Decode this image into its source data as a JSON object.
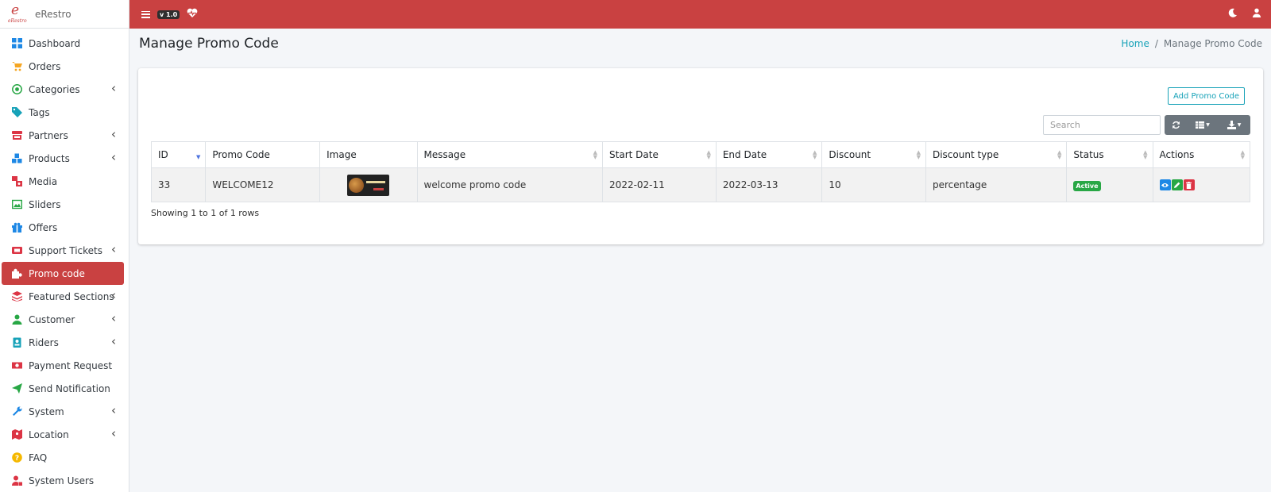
{
  "brand": {
    "name": "eRestro",
    "logo_text": "eRestro"
  },
  "sidebar": {
    "items": [
      {
        "label": "Dashboard",
        "icon": "dashboard-icon",
        "color": "#1e88e5",
        "chevron": false,
        "active": false
      },
      {
        "label": "Orders",
        "icon": "cart-icon",
        "color": "#f5a623",
        "chevron": false,
        "active": false
      },
      {
        "label": "Categories",
        "icon": "bullseye-icon",
        "color": "#28a745",
        "chevron": true,
        "active": false
      },
      {
        "label": "Tags",
        "icon": "tag-icon",
        "color": "#17a2b8",
        "chevron": false,
        "active": false
      },
      {
        "label": "Partners",
        "icon": "store-icon",
        "color": "#dc3545",
        "chevron": true,
        "active": false
      },
      {
        "label": "Products",
        "icon": "cubes-icon",
        "color": "#1e88e5",
        "chevron": true,
        "active": false
      },
      {
        "label": "Media",
        "icon": "photo-video-icon",
        "color": "#dc3545",
        "chevron": false,
        "active": false
      },
      {
        "label": "Sliders",
        "icon": "image-icon",
        "color": "#28a745",
        "chevron": false,
        "active": false
      },
      {
        "label": "Offers",
        "icon": "gift-icon",
        "color": "#1e88e5",
        "chevron": false,
        "active": false
      },
      {
        "label": "Support Tickets",
        "icon": "ticket-icon",
        "color": "#dc3545",
        "chevron": true,
        "active": false
      },
      {
        "label": "Promo code",
        "icon": "puzzle-icon",
        "color": "#ffffff",
        "chevron": false,
        "active": true
      },
      {
        "label": "Featured Sections",
        "icon": "layers-icon",
        "color": "#dc3545",
        "chevron": true,
        "active": false
      },
      {
        "label": "Customer",
        "icon": "user-icon",
        "color": "#28a745",
        "chevron": true,
        "active": false
      },
      {
        "label": "Riders",
        "icon": "id-badge-icon",
        "color": "#17a2b8",
        "chevron": true,
        "active": false
      },
      {
        "label": "Payment Request",
        "icon": "money-icon",
        "color": "#dc3545",
        "chevron": false,
        "active": false
      },
      {
        "label": "Send Notification",
        "icon": "paper-plane-icon",
        "color": "#28a745",
        "chevron": false,
        "active": false
      },
      {
        "label": "System",
        "icon": "wrench-icon",
        "color": "#1e88e5",
        "chevron": true,
        "active": false
      },
      {
        "label": "Location",
        "icon": "map-icon",
        "color": "#dc3545",
        "chevron": true,
        "active": false
      },
      {
        "label": "FAQ",
        "icon": "question-circle-icon",
        "color": "#f5b800",
        "chevron": false,
        "active": false
      },
      {
        "label": "System Users",
        "icon": "user-lock-icon",
        "color": "#dc3545",
        "chevron": false,
        "active": false
      }
    ]
  },
  "topbar": {
    "version": "v 1.0",
    "accent": "#c94141"
  },
  "page": {
    "title": "Manage Promo Code"
  },
  "breadcrumb": {
    "home": "Home",
    "separator": "/",
    "current": "Manage Promo Code"
  },
  "toolbar": {
    "add_label": "Add Promo Code",
    "search_placeholder": "Search"
  },
  "table": {
    "columns": [
      "ID",
      "Promo Code",
      "Image",
      "Message",
      "Start Date",
      "End Date",
      "Discount",
      "Discount type",
      "Status",
      "Actions"
    ],
    "rows": [
      {
        "id": "33",
        "promo_code": "WELCOME12",
        "message": "welcome promo code",
        "start_date": "2022-02-11",
        "end_date": "2022-03-13",
        "discount": "10",
        "discount_type": "percentage",
        "status": "Active"
      }
    ],
    "footer": "Showing 1 to 1 of 1 rows"
  }
}
